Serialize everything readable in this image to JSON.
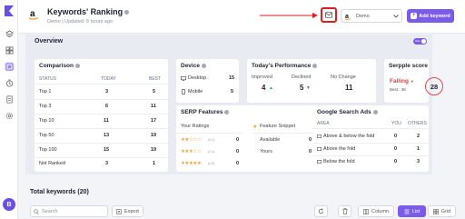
{
  "header": {
    "title": "Keywords' Ranking",
    "subtitle": "Demo | Updated: 8 hours ago",
    "project_select": {
      "value": "Demo"
    },
    "add_keyword_label": "Add keyword"
  },
  "overview": {
    "title": "Overview",
    "toggle_label": "hide",
    "comparison": {
      "title": "Comparison",
      "headers": [
        "STATUS",
        "TODAY",
        "BEST"
      ],
      "rows": [
        {
          "status": "Top 1",
          "today": "3",
          "best": "5"
        },
        {
          "status": "Top 3",
          "today": "6",
          "best": "11"
        },
        {
          "status": "Top 10",
          "today": "11",
          "best": "17"
        },
        {
          "status": "Top 50",
          "today": "13",
          "best": "19"
        },
        {
          "status": "Top 100",
          "today": "15",
          "best": "19"
        },
        {
          "status": "Not Ranked",
          "today": "3",
          "best": "1"
        }
      ]
    },
    "device": {
      "title": "Device",
      "rows": [
        {
          "label": "Desktop",
          "value": "15",
          "icon": "desktop-icon"
        },
        {
          "label": "Mobile",
          "value": "5",
          "icon": "mobile-icon"
        }
      ]
    },
    "performance": {
      "title": "Today's Performance",
      "improved": {
        "label": "Improved",
        "value": "4"
      },
      "declined": {
        "label": "Declined",
        "value": "5"
      },
      "no_change": {
        "label": "No Change",
        "value": "11"
      }
    },
    "serpple_score": {
      "title": "Serpple score",
      "status": "Falling",
      "best": "Best : 38",
      "score": "28"
    },
    "serp_features": {
      "title": "SERP Features",
      "your_ratings": "Your Ratings",
      "feature_snippet": "Feature Snippet",
      "ratings": [
        {
          "stars": "★★☆☆☆",
          "range": "(0-2)",
          "value": "0"
        },
        {
          "stars": "★★★☆☆",
          "range": "(2-4)",
          "value": "0"
        },
        {
          "stars": "★★★★★",
          "range": "(4-5)",
          "value": "0"
        }
      ],
      "snippet_rows": [
        {
          "label": "Available",
          "value": "0"
        },
        {
          "label": "Yours",
          "value": "0"
        }
      ]
    },
    "google_ads": {
      "title": "Google Search Ads",
      "headers": [
        "AREA",
        "YOU",
        "OTHERS"
      ],
      "rows": [
        {
          "area": "Above & below the fold",
          "you": "0",
          "others": "2"
        },
        {
          "area": "Above the fold",
          "you": "0",
          "others": "1"
        },
        {
          "area": "Below the fold",
          "you": "0",
          "others": "3"
        }
      ]
    }
  },
  "keywords": {
    "title": "Total keywords (20)",
    "search_placeholder": "Search",
    "export_label": "Export",
    "column_label": "Column",
    "list_label": "List",
    "grid_label": "Grid"
  },
  "user": {
    "initial": "B"
  },
  "colors": {
    "accent": "#7a5ce9",
    "highlight": "#e01e1e",
    "improved": "#2bb673",
    "declined": "#e03b3b"
  }
}
